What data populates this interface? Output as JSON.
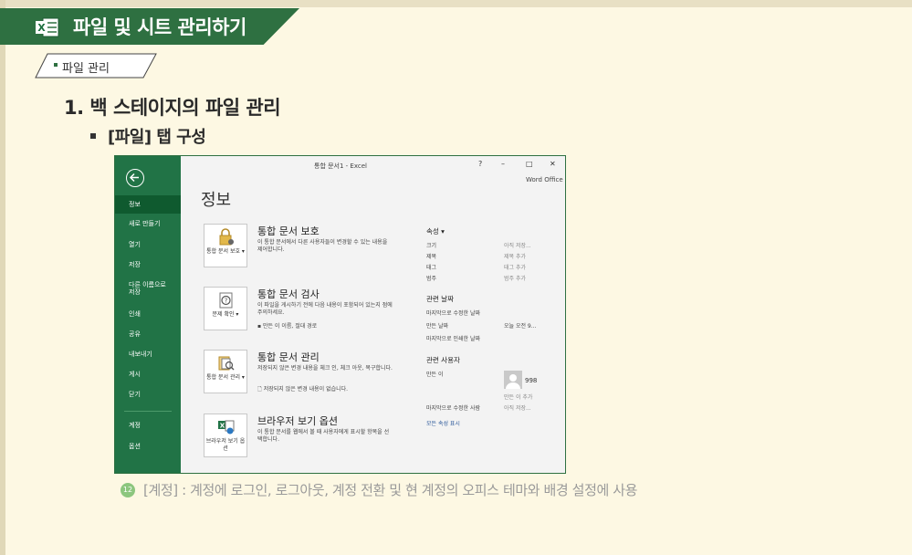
{
  "header": {
    "title": "파일 및 시트 관리하기",
    "subtab": "파일 관리",
    "section": "1. 백 스테이지의 파일 관리",
    "subsection": "[파일] 탭 구성"
  },
  "excel": {
    "window_title": "통합 문서1 - Excel",
    "controls": {
      "help": "?",
      "minimize": "–",
      "maximize": "□",
      "close": "✕"
    },
    "account": "Word Office",
    "page_title": "정보",
    "sidebar": [
      {
        "label": "정보"
      },
      {
        "label": "새로 만들기"
      },
      {
        "label": "열기"
      },
      {
        "label": "저장"
      },
      {
        "label": "다른 이름으로 저장"
      },
      {
        "label": "인쇄"
      },
      {
        "label": "공유"
      },
      {
        "label": "내보내기"
      },
      {
        "label": "게시"
      },
      {
        "label": "닫기"
      },
      {
        "label": "계정"
      },
      {
        "label": "옵션"
      }
    ],
    "cards": [
      {
        "button_label": "통합 문서 보호 ▾",
        "title": "통합 문서 보호",
        "desc": "이 통합 문서에서 다른 사용자들이 변경할 수 있는 내용을 제어합니다.",
        "sub": ""
      },
      {
        "button_label": "문제 확인 ▾",
        "title": "통합 문서 검사",
        "desc": "이 파일을 게시하기 전에 다음 내용이 포함되어 있는지 점에 주의하세요.",
        "sub": "▪ 만든 이 이름, 절대 경로"
      },
      {
        "button_label": "통합 문서 관리 ▾",
        "title": "통합 문서 관리",
        "desc": "저장되지 않은 변경 내용을 체크 인, 체크 아웃, 복구합니다.",
        "sub": "저장되지 않은 변경 내용이 없습니다."
      },
      {
        "button_label": "브라우저 보기 옵션",
        "title": "브라우저 보기 옵션",
        "desc": "이 통합 문서를 웹에서 볼 때 사용자에게 표시할 항목을 선택합니다.",
        "sub": ""
      }
    ],
    "properties": {
      "heading": "속성 ▾",
      "rows": [
        {
          "key": "크기",
          "value": "아직 저장..."
        },
        {
          "key": "제목",
          "value": "제목 추가"
        },
        {
          "key": "태그",
          "value": "태그 추가"
        },
        {
          "key": "범주",
          "value": "범주 추가"
        }
      ],
      "dates_heading": "관련 날짜",
      "dates": [
        {
          "key": "마지막으로 수정한 날짜",
          "value": ""
        },
        {
          "key": "만든 날짜",
          "value": "오늘 오전 9..."
        },
        {
          "key": "마지막으로 인쇄한 날짜",
          "value": ""
        }
      ],
      "people_heading": "관련 사용자",
      "author_key": "만든 이",
      "author_name": "998",
      "add_author": "만든 이 추가",
      "last_modified_by_key": "마지막으로 수정한 사람",
      "last_modified_by_value": "아직 저장...",
      "show_all": "모든 속성 표시"
    }
  },
  "caption": {
    "number": "12",
    "text": "[계정] : 계정에 로그인, 로그아웃, 계정 전환 및 현 계정의 오피스 테마와 배경 설정에 사용"
  },
  "colors": {
    "excel_green": "#217346",
    "banner_green": "#2e7041",
    "background": "#fdf8e3"
  }
}
